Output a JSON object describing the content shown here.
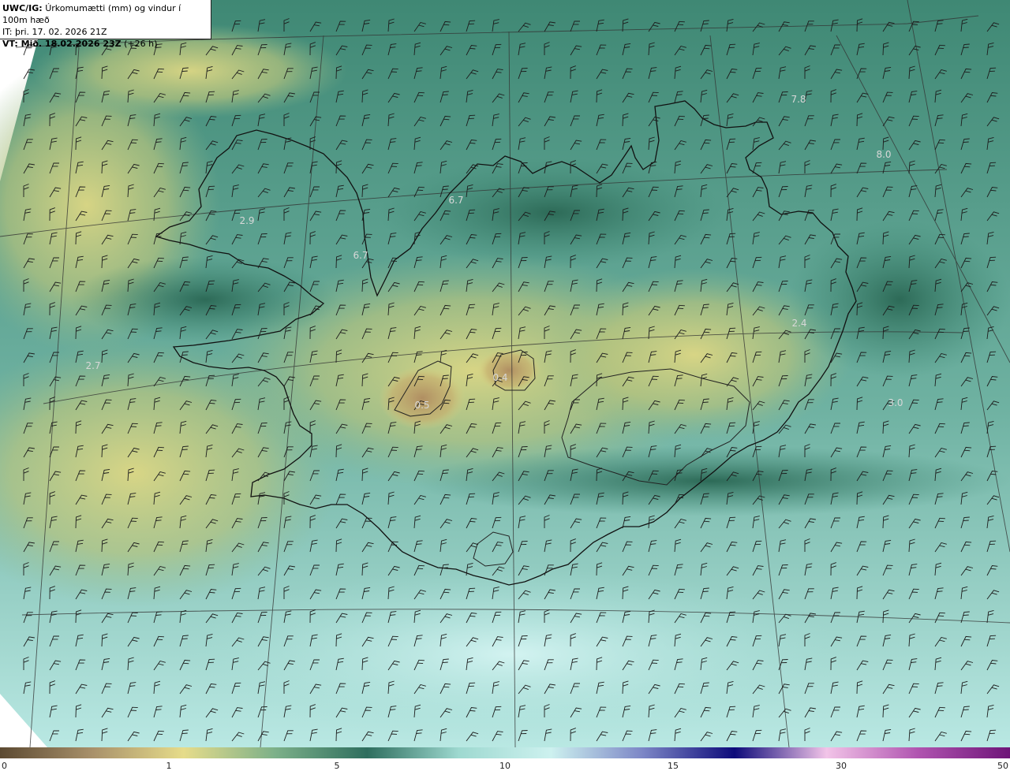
{
  "header": {
    "model": "UWC/IG:",
    "product": "Úrkomumætti (mm) og vindur í 100m hæð",
    "issue_time": "IT: þri. 17. 02. 2026 21Z",
    "valid_label": "VT: Mið. 18.02.2026 23Z",
    "lead_time": "(+26 h)"
  },
  "map_labels": [
    {
      "name": "map-value-label",
      "text": "2.9"
    },
    {
      "name": "map-value-label",
      "text": "6.7"
    },
    {
      "name": "map-value-label",
      "text": "6.7"
    },
    {
      "name": "map-value-label",
      "text": "0.5"
    },
    {
      "name": "map-value-label",
      "text": "0.4"
    },
    {
      "name": "map-value-label",
      "text": "2.4"
    },
    {
      "name": "map-value-label",
      "text": "3.0"
    },
    {
      "name": "map-value-label",
      "text": "8.0"
    },
    {
      "name": "map-value-label",
      "text": "7.8"
    },
    {
      "name": "map-value-label",
      "text": "2.7"
    }
  ],
  "colorbar": {
    "ticks": [
      "0",
      "1",
      "5",
      "10",
      "15",
      "30",
      "50"
    ],
    "colors": [
      "#5c4a32",
      "#a8906a",
      "#e6dc8a",
      "#7cb089",
      "#2e6e5e",
      "#9ed9d0",
      "#cdf1ef",
      "#7c86c6",
      "#0d0a7a",
      "#f2c4e8",
      "#b054b0",
      "#6e1478"
    ]
  }
}
